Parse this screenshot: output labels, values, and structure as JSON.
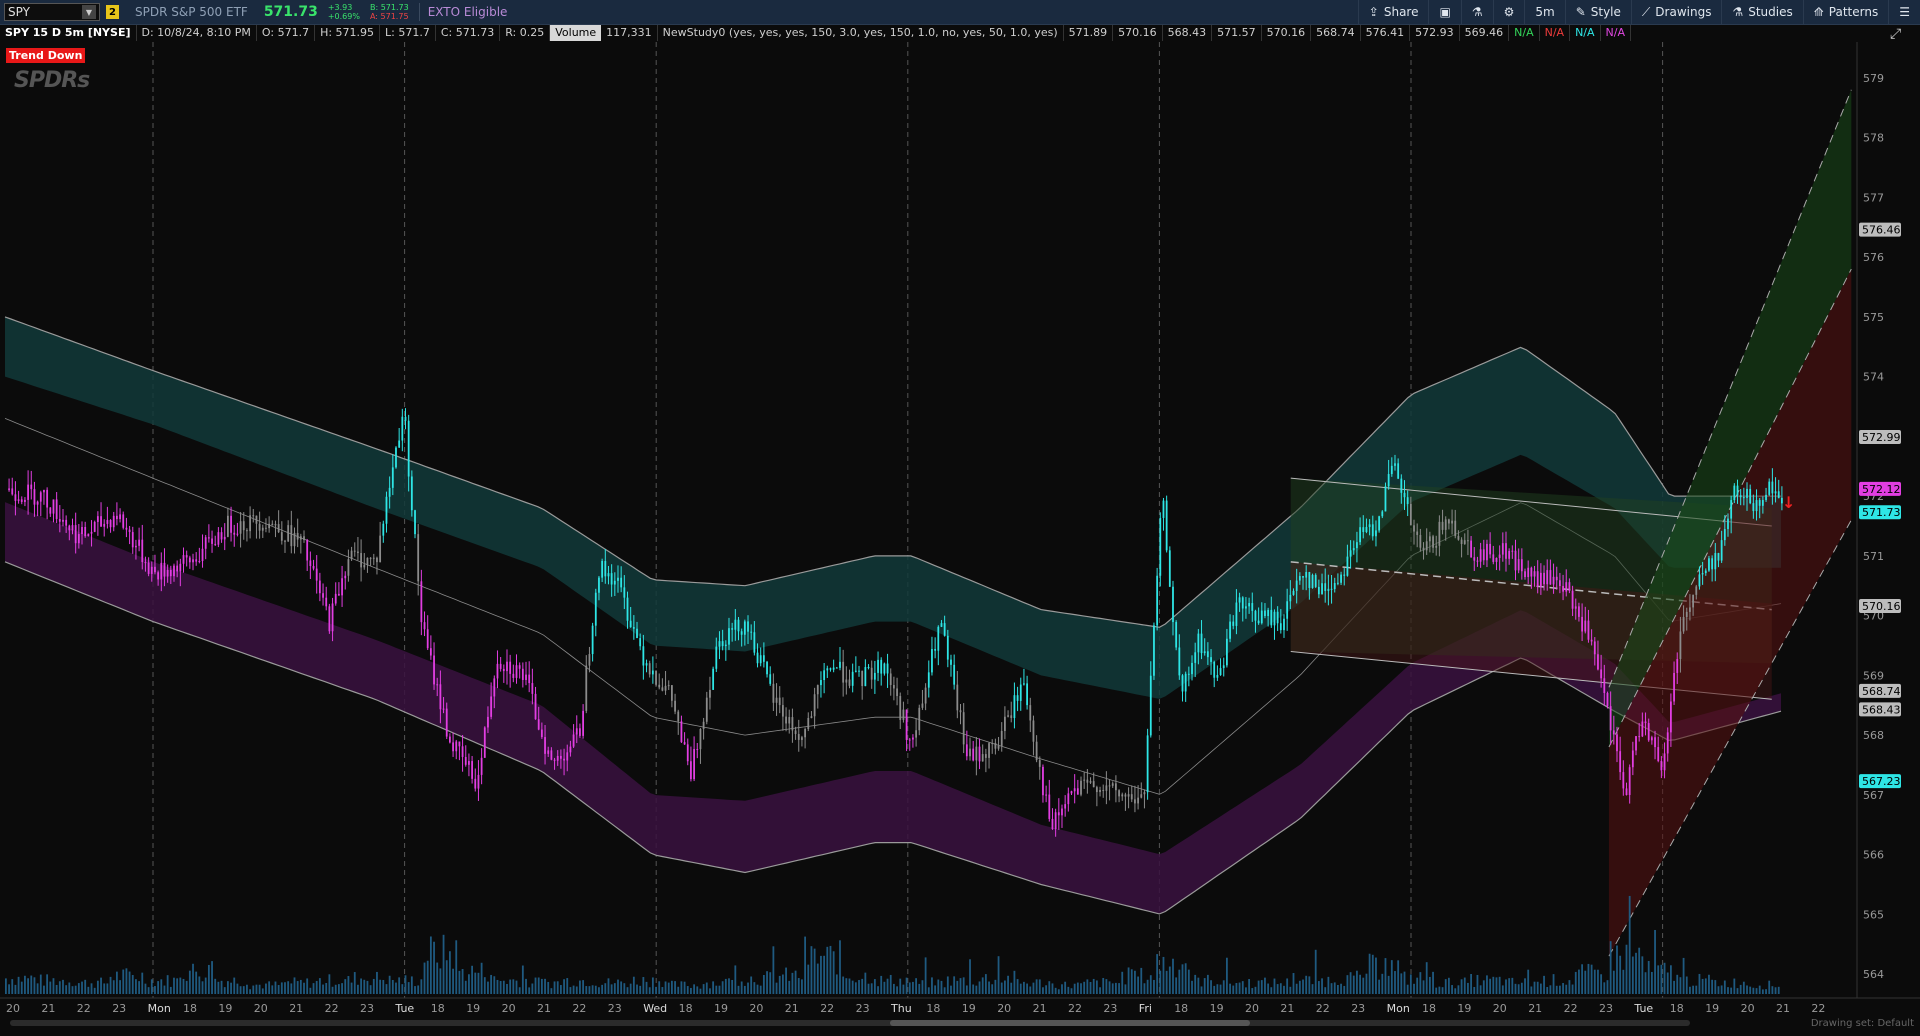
{
  "toolbar": {
    "symbol": "SPY",
    "badge": "2",
    "description": "SPDR S&P 500 ETF",
    "last": "571.73",
    "change_abs": "+3.93",
    "change_pct": "+0.69%",
    "bid": "B: 571.73",
    "ask": "A: 571.75",
    "exto": "EXTO Eligible",
    "buttons": [
      {
        "label": "Share",
        "icon": "share-icon"
      },
      {
        "label": "",
        "icon": "snapshot-icon"
      },
      {
        "label": "",
        "icon": "flask-icon"
      },
      {
        "label": "",
        "icon": "gear-icon"
      },
      {
        "label": "5m",
        "icon": ""
      },
      {
        "label": "Style",
        "icon": "style-icon"
      },
      {
        "label": "Drawings",
        "icon": "drawings-icon"
      },
      {
        "label": "Studies",
        "icon": "studies-icon"
      },
      {
        "label": "Patterns",
        "icon": "patterns-icon"
      }
    ]
  },
  "infobar": {
    "title": "SPY 15 D 5m [NYSE]",
    "date": "D: 10/8/24, 8:10 PM",
    "open": "O: 571.7",
    "high": "H: 571.95",
    "low": "L: 571.7",
    "close": "C: 571.73",
    "range": "R: 0.25",
    "volume_label": "Volume",
    "volume_value": "117,331",
    "study": "NewStudy0 (yes, yes, yes, 150, 3.0, yes, 150, 1.0, no, yes, 50, 1.0, yes)",
    "study_values": [
      "571.89",
      "570.16",
      "568.43",
      "571.57",
      "570.16",
      "568.74",
      "576.41",
      "572.93",
      "569.46"
    ],
    "na": [
      "N/A",
      "N/A",
      "N/A",
      "N/A"
    ]
  },
  "trend_label": "Trend Down",
  "logo_text": "SPDRs",
  "drawing_set": "Drawing set: Default",
  "colors": {
    "cyan": "#2ee6e6",
    "magenta": "#e23ee2",
    "grey_candle": "#8c8c8c",
    "teal_band": "#123a3a",
    "purple_band": "#3a1240",
    "volume": "#1f5a80"
  },
  "chart_data": {
    "type": "candlestick",
    "ylim": [
      563.6,
      579.6
    ],
    "y_ticks": [
      "564",
      "565",
      "566",
      "567",
      "568",
      "569",
      "570",
      "571",
      "572",
      "573",
      "574",
      "575",
      "576",
      "577",
      "578",
      "579"
    ],
    "x_ticks": [
      "20",
      "21",
      "22",
      "23",
      "Mon",
      "18",
      "19",
      "20",
      "21",
      "22",
      "23",
      "Tue",
      "18",
      "19",
      "20",
      "21",
      "22",
      "23",
      "Wed",
      "18",
      "19",
      "20",
      "21",
      "22",
      "23",
      "Thu",
      "18",
      "19",
      "20",
      "21",
      "22",
      "23",
      "Fri",
      "18",
      "19",
      "20",
      "21",
      "22",
      "23",
      "Mon",
      "18",
      "19",
      "20",
      "21",
      "22",
      "23",
      "Tue",
      "18",
      "19",
      "20",
      "21",
      "22"
    ],
    "price_labels": [
      {
        "value": 576.46,
        "text": "576.46",
        "color": "#bdbdbd"
      },
      {
        "value": 572.99,
        "text": "572.99",
        "color": "#bdbdbd"
      },
      {
        "value": 572.12,
        "text": "572.12",
        "color": "#e23ee2"
      },
      {
        "value": 571.73,
        "text": "571.73",
        "color": "#2ee6e6"
      },
      {
        "value": 570.16,
        "text": "570.16",
        "color": "#bdbdbd"
      },
      {
        "value": 568.74,
        "text": "568.74",
        "color": "#bdbdbd"
      },
      {
        "value": 568.43,
        "text": "568.43",
        "color": "#bdbdbd"
      },
      {
        "value": 567.23,
        "text": "567.23",
        "color": "#2ee6e6"
      }
    ],
    "close_path": [
      [
        0,
        572.1
      ],
      [
        0.02,
        572.0
      ],
      [
        0.04,
        571.3
      ],
      [
        0.06,
        571.7
      ],
      [
        0.08,
        570.7
      ],
      [
        0.1,
        570.9
      ],
      [
        0.12,
        571.5
      ],
      [
        0.14,
        571.6
      ],
      [
        0.16,
        571.2
      ],
      [
        0.175,
        569.9
      ],
      [
        0.185,
        571.0
      ],
      [
        0.2,
        570.9
      ],
      [
        0.215,
        573.5
      ],
      [
        0.225,
        569.8
      ],
      [
        0.24,
        567.9
      ],
      [
        0.255,
        567.2
      ],
      [
        0.265,
        569.3
      ],
      [
        0.28,
        569.0
      ],
      [
        0.295,
        567.5
      ],
      [
        0.31,
        568.0
      ],
      [
        0.32,
        570.8
      ],
      [
        0.33,
        570.6
      ],
      [
        0.345,
        569.3
      ],
      [
        0.36,
        568.6
      ],
      [
        0.37,
        567.3
      ],
      [
        0.385,
        569.6
      ],
      [
        0.4,
        569.9
      ],
      [
        0.415,
        568.6
      ],
      [
        0.43,
        567.9
      ],
      [
        0.445,
        569.2
      ],
      [
        0.46,
        568.9
      ],
      [
        0.475,
        569.2
      ],
      [
        0.49,
        567.8
      ],
      [
        0.505,
        569.9
      ],
      [
        0.52,
        567.6
      ],
      [
        0.535,
        567.8
      ],
      [
        0.55,
        568.9
      ],
      [
        0.565,
        566.4
      ],
      [
        0.575,
        567.0
      ],
      [
        0.59,
        567.2
      ],
      [
        0.6,
        567.0
      ],
      [
        0.615,
        566.9
      ],
      [
        0.625,
        572.0
      ],
      [
        0.635,
        568.6
      ],
      [
        0.645,
        569.6
      ],
      [
        0.655,
        568.9
      ],
      [
        0.665,
        570.2
      ],
      [
        0.675,
        570.0
      ],
      [
        0.69,
        569.9
      ],
      [
        0.7,
        570.8
      ],
      [
        0.71,
        570.4
      ],
      [
        0.72,
        570.6
      ],
      [
        0.73,
        571.3
      ],
      [
        0.74,
        571.5
      ],
      [
        0.75,
        572.5
      ],
      [
        0.765,
        571.0
      ],
      [
        0.78,
        571.6
      ],
      [
        0.795,
        571.0
      ],
      [
        0.81,
        571.1
      ],
      [
        0.825,
        570.6
      ],
      [
        0.84,
        570.6
      ],
      [
        0.855,
        569.7
      ],
      [
        0.865,
        568.5
      ],
      [
        0.875,
        567.0
      ],
      [
        0.885,
        568.4
      ],
      [
        0.895,
        567.3
      ],
      [
        0.905,
        569.8
      ],
      [
        0.915,
        570.6
      ],
      [
        0.925,
        571.0
      ],
      [
        0.935,
        572.1
      ],
      [
        0.945,
        571.9
      ],
      [
        0.955,
        572.2
      ],
      [
        0.96,
        571.73
      ]
    ],
    "bands": {
      "upper_outer": [
        [
          0,
          575.0
        ],
        [
          0.08,
          574.1
        ],
        [
          0.2,
          572.8
        ],
        [
          0.29,
          571.8
        ],
        [
          0.35,
          570.6
        ],
        [
          0.4,
          570.5
        ],
        [
          0.47,
          571.0
        ],
        [
          0.49,
          571.0
        ],
        [
          0.56,
          570.1
        ],
        [
          0.625,
          569.8
        ],
        [
          0.7,
          571.8
        ],
        [
          0.76,
          573.7
        ],
        [
          0.82,
          574.5
        ],
        [
          0.87,
          573.4
        ],
        [
          0.9,
          572.0
        ],
        [
          0.96,
          572.0
        ]
      ],
      "upper_inner": [
        [
          0,
          574.0
        ],
        [
          0.08,
          573.2
        ],
        [
          0.2,
          571.8
        ],
        [
          0.29,
          570.8
        ],
        [
          0.35,
          569.5
        ],
        [
          0.4,
          569.4
        ],
        [
          0.47,
          569.9
        ],
        [
          0.49,
          569.9
        ],
        [
          0.56,
          569.0
        ],
        [
          0.625,
          568.6
        ],
        [
          0.7,
          570.2
        ],
        [
          0.76,
          571.9
        ],
        [
          0.82,
          572.7
        ],
        [
          0.87,
          571.8
        ],
        [
          0.9,
          570.8
        ],
        [
          0.96,
          570.8
        ]
      ],
      "mid": [
        [
          0,
          573.3
        ],
        [
          0.08,
          572.3
        ],
        [
          0.2,
          570.8
        ],
        [
          0.29,
          569.7
        ],
        [
          0.35,
          568.3
        ],
        [
          0.4,
          568.0
        ],
        [
          0.47,
          568.3
        ],
        [
          0.49,
          568.3
        ],
        [
          0.56,
          567.6
        ],
        [
          0.625,
          567.0
        ],
        [
          0.7,
          569.0
        ],
        [
          0.76,
          571.0
        ],
        [
          0.82,
          571.9
        ],
        [
          0.87,
          571.0
        ],
        [
          0.9,
          569.9
        ],
        [
          0.96,
          570.2
        ]
      ],
      "lower_inner": [
        [
          0,
          571.9
        ],
        [
          0.08,
          570.9
        ],
        [
          0.2,
          569.6
        ],
        [
          0.29,
          568.5
        ],
        [
          0.35,
          567.0
        ],
        [
          0.4,
          566.9
        ],
        [
          0.47,
          567.4
        ],
        [
          0.49,
          567.4
        ],
        [
          0.56,
          566.5
        ],
        [
          0.625,
          566.0
        ],
        [
          0.7,
          567.5
        ],
        [
          0.76,
          569.2
        ],
        [
          0.82,
          570.1
        ],
        [
          0.87,
          569.2
        ],
        [
          0.9,
          568.2
        ],
        [
          0.96,
          568.7
        ]
      ],
      "lower_outer": [
        [
          0,
          570.9
        ],
        [
          0.08,
          569.9
        ],
        [
          0.2,
          568.6
        ],
        [
          0.29,
          567.4
        ],
        [
          0.35,
          566.0
        ],
        [
          0.4,
          565.7
        ],
        [
          0.47,
          566.2
        ],
        [
          0.49,
          566.2
        ],
        [
          0.56,
          565.5
        ],
        [
          0.625,
          565.0
        ],
        [
          0.7,
          566.6
        ],
        [
          0.76,
          568.4
        ],
        [
          0.82,
          569.3
        ],
        [
          0.87,
          568.4
        ],
        [
          0.9,
          567.9
        ],
        [
          0.96,
          568.4
        ]
      ]
    },
    "volume_relative": [
      0.35,
      0.3,
      0.25,
      0.4,
      0.3,
      0.5,
      0.3,
      0.2,
      0.25,
      0.3,
      0.35,
      0.3,
      0.9,
      0.5,
      0.3,
      0.25,
      0.3,
      0.25,
      0.3,
      0.2,
      0.25,
      0.35,
      0.4,
      0.8,
      0.4,
      0.3,
      0.25,
      0.3,
      0.35,
      0.25,
      0.2,
      0.25,
      0.4,
      0.7,
      0.3,
      0.25,
      0.25,
      0.3,
      0.35,
      0.6,
      0.35,
      0.25,
      0.3,
      0.25,
      0.3,
      0.45,
      0.85,
      0.5,
      0.3,
      0.25,
      0.2
    ]
  }
}
